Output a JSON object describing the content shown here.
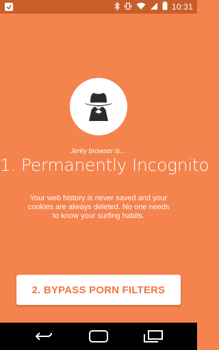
{
  "status_bar": {
    "time": "10:31",
    "icons": [
      "app-notification-icon",
      "bluetooth-icon",
      "vibrate-icon",
      "wifi-icon",
      "cellular-signal-icon",
      "battery-icon"
    ]
  },
  "onboarding": {
    "icon": "incognito-spy-icon",
    "subtitle": "Jerky browser is…",
    "title": "1. Permanently Incognito",
    "description": "Your web history is never saved and your cookies are always deleted. No one needs to know your surfing habits.",
    "next_button_label": "2. BYPASS PORN FILTERS"
  },
  "nav_bar": {
    "buttons": [
      "back-icon",
      "home-icon",
      "recents-icon"
    ]
  },
  "colors": {
    "background": "#f5834d",
    "status_bar": "#c85f2b",
    "button_text": "#f1763e",
    "icon_dark": "#2b2b2b"
  }
}
